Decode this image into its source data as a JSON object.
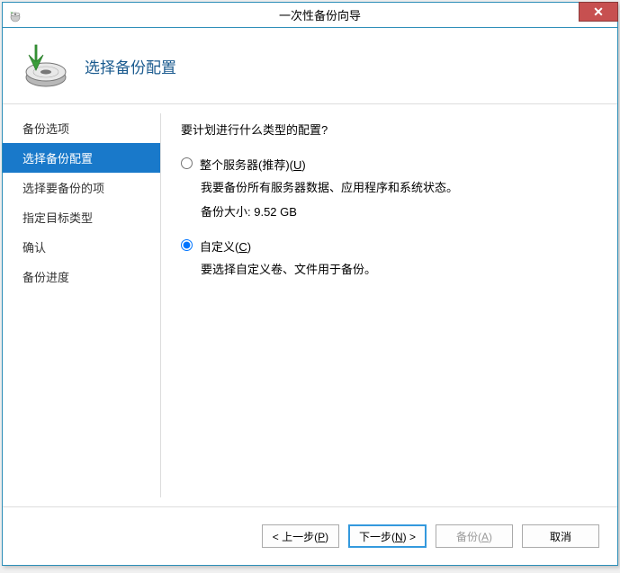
{
  "titlebar": {
    "title": "一次性备份向导"
  },
  "header": {
    "title": "选择备份配置"
  },
  "sidebar": {
    "items": [
      {
        "label": "备份选项",
        "active": false
      },
      {
        "label": "选择备份配置",
        "active": true
      },
      {
        "label": "选择要备份的项",
        "active": false
      },
      {
        "label": "指定目标类型",
        "active": false
      },
      {
        "label": "确认",
        "active": false
      },
      {
        "label": "备份进度",
        "active": false
      }
    ]
  },
  "content": {
    "heading": "要计划进行什么类型的配置?",
    "options": [
      {
        "id": "full",
        "label_pre": "整个服务器(推荐)(",
        "label_key": "U",
        "label_post": ")",
        "checked": false,
        "desc1": "我要备份所有服务器数据、应用程序和系统状态。",
        "desc2": "备份大小: 9.52 GB"
      },
      {
        "id": "custom",
        "label_pre": "自定义(",
        "label_key": "C",
        "label_post": ")",
        "checked": true,
        "desc1": "要选择自定义卷、文件用于备份。",
        "desc2": ""
      }
    ]
  },
  "footer": {
    "prev_pre": "< 上一步(",
    "prev_key": "P",
    "prev_post": ")",
    "next_pre": "下一步(",
    "next_key": "N",
    "next_post": ") >",
    "backup_pre": "备份(",
    "backup_key": "A",
    "backup_post": ")",
    "cancel": "取消"
  }
}
